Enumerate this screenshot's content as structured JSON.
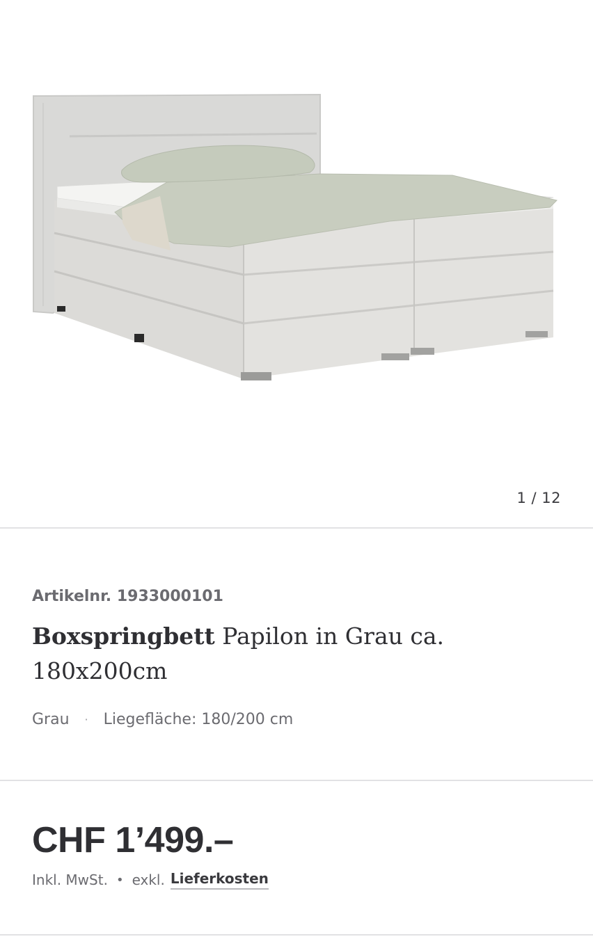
{
  "gallery": {
    "image_alt": "Boxspringbett Papilon in Grau",
    "counter": "1 / 12"
  },
  "product": {
    "article_number": "Artikelnr. 1933000101",
    "title_bold": "Boxspringbett",
    "title_rest": " Papilon in Grau ca. 180x200cm",
    "attributes": [
      "Grau",
      "Liegefläche: 180/200 cm"
    ],
    "attribute_separator": "·"
  },
  "pricing": {
    "price": "CHF 1’499.–",
    "vat_text": "Inkl. MwSt.",
    "bullet": "•",
    "delivery_prefix": "exkl.",
    "delivery_link": "Lieferkosten"
  },
  "colors": {
    "text_primary": "#2f2f33",
    "text_secondary": "#6b6b70",
    "divider": "#e2e2e4"
  }
}
